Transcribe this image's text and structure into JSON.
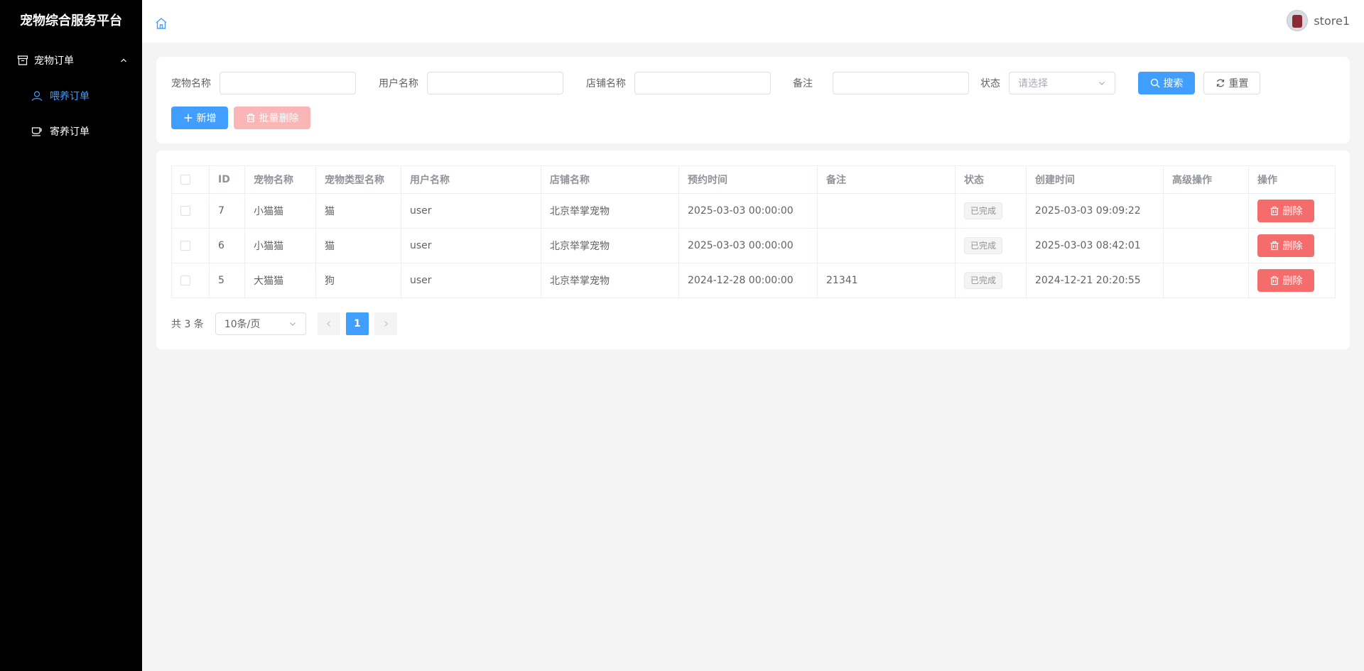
{
  "app": {
    "title": "宠物综合服务平台"
  },
  "sidebar": {
    "group": {
      "label": "宠物订单",
      "icon": "box-icon",
      "expanded": true
    },
    "items": [
      {
        "label": "喂养订单",
        "icon": "user-icon",
        "active": true
      },
      {
        "label": "寄养订单",
        "icon": "cup-icon",
        "active": false
      }
    ]
  },
  "header": {
    "home_icon": "home-icon",
    "username": "store1"
  },
  "search": {
    "pet_name_label": "宠物名称",
    "pet_name_value": "",
    "user_name_label": "用户名称",
    "user_name_value": "",
    "store_name_label": "店铺名称",
    "store_name_value": "",
    "remark_label": "备注",
    "remark_value": "",
    "status_label": "状态",
    "status_placeholder": "请选择",
    "search_button": "搜索",
    "reset_button": "重置"
  },
  "toolbar": {
    "add_button": "新增",
    "batch_delete_button": "批量删除"
  },
  "table": {
    "columns": [
      "ID",
      "宠物名称",
      "宠物类型名称",
      "用户名称",
      "店铺名称",
      "预约时间",
      "备注",
      "状态",
      "创建时间",
      "高级操作",
      "操作"
    ],
    "rows": [
      {
        "id": "7",
        "pet_name": "小猫猫",
        "pet_type": "猫",
        "user_name": "user",
        "store_name": "北京举掌宠物",
        "appointment_time": "2025-03-03 00:00:00",
        "remark": "",
        "status": "已完成",
        "created_time": "2025-03-03 09:09:22",
        "advanced": "",
        "action": "删除"
      },
      {
        "id": "6",
        "pet_name": "小猫猫",
        "pet_type": "猫",
        "user_name": "user",
        "store_name": "北京举掌宠物",
        "appointment_time": "2025-03-03 00:00:00",
        "remark": "",
        "status": "已完成",
        "created_time": "2025-03-03 08:42:01",
        "advanced": "",
        "action": "删除"
      },
      {
        "id": "5",
        "pet_name": "大猫猫",
        "pet_type": "狗",
        "user_name": "user",
        "store_name": "北京举掌宠物",
        "appointment_time": "2024-12-28 00:00:00",
        "remark": "21341",
        "status": "已完成",
        "created_time": "2024-12-21 20:20:55",
        "advanced": "",
        "action": "删除"
      }
    ]
  },
  "pagination": {
    "total_text": "共 3 条",
    "page_size": "10条/页",
    "current_page": "1"
  },
  "colors": {
    "primary": "#409eff",
    "danger": "#f56c6c",
    "sidebar_bg": "#000000"
  }
}
